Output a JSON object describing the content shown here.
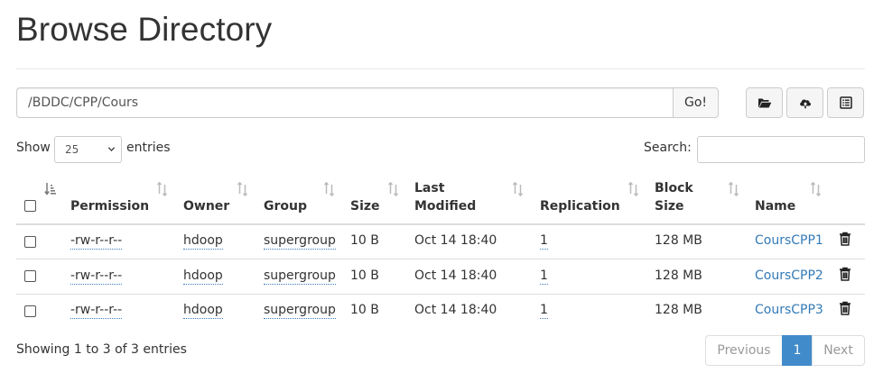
{
  "page": {
    "title": "Browse Directory"
  },
  "path_bar": {
    "value": "/BDDC/CPP/Cours",
    "go_label": "Go!"
  },
  "toolbar": {
    "icons": [
      "folder-open-icon",
      "cloud-upload-icon",
      "list-icon"
    ]
  },
  "length_control": {
    "show_label": "Show",
    "selected": "25",
    "entries_label": "entries"
  },
  "search": {
    "label": "Search:",
    "value": ""
  },
  "table": {
    "headers": {
      "permission": "Permission",
      "owner": "Owner",
      "group": "Group",
      "size": "Size",
      "last_modified_1": "Last",
      "last_modified_2": "Modified",
      "replication": "Replication",
      "block_size_1": "Block",
      "block_size_2": "Size",
      "name": "Name"
    },
    "rows": [
      {
        "permission": "-rw-r--r--",
        "owner": "hdoop",
        "group": "supergroup",
        "size": "10 B",
        "modified": "Oct 14 18:40",
        "replication": "1",
        "block_size": "128 MB",
        "name": "CoursCPP1"
      },
      {
        "permission": "-rw-r--r--",
        "owner": "hdoop",
        "group": "supergroup",
        "size": "10 B",
        "modified": "Oct 14 18:40",
        "replication": "1",
        "block_size": "128 MB",
        "name": "CoursCPP2"
      },
      {
        "permission": "-rw-r--r--",
        "owner": "hdoop",
        "group": "supergroup",
        "size": "10 B",
        "modified": "Oct 14 18:40",
        "replication": "1",
        "block_size": "128 MB",
        "name": "CoursCPP3"
      }
    ]
  },
  "footer": {
    "info": "Showing 1 to 3 of 3 entries",
    "previous": "Previous",
    "current_page": "1",
    "next": "Next"
  },
  "colors": {
    "link": "#337ab7",
    "active_page": "#428bca",
    "border": "#dddddd"
  }
}
